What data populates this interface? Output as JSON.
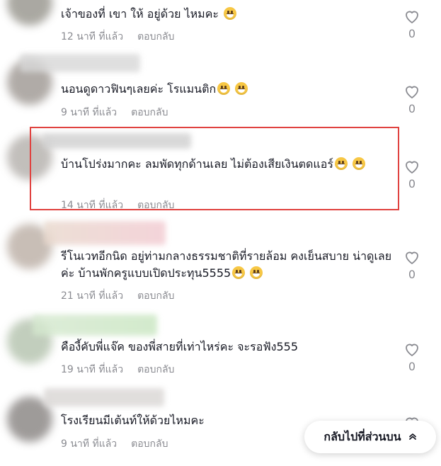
{
  "comments": [
    {
      "text": "เจ้าของที่ เขา ให้ อยู่ด้วย ไหมคะ",
      "emojis": [
        "grin-emoji"
      ],
      "time": "12 นาที ที่แล้ว",
      "reply": "ตอบกลับ",
      "likes": "0"
    },
    {
      "text": "นอนดูดาวฟินๆเลยค่ะ โรแมนติก",
      "emojis": [
        "smile-emoji",
        "smile-emoji"
      ],
      "time": "9 นาที ที่แล้ว",
      "reply": "ตอบกลับ",
      "likes": "0"
    },
    {
      "text": "บ้านโปร่งมากคะ ลมพัดทุกด้านเลย ไม่ต้องเสียเงินตดแอร์",
      "emojis": [
        "rofl-emoji",
        "rofl-emoji"
      ],
      "time": "14 นาที ที่แล้ว",
      "reply": "ตอบกลับ",
      "likes": "0"
    },
    {
      "text": "รีโนเวทอีกนิด อยู่ท่ามกลางธรรมชาติที่รายล้อม คงเย็นสบาย น่าดูเลยค่ะ บ้านพักครูแบบเปิดประทุน5555",
      "emojis": [
        "laugh-tears-emoji",
        "sweat-smile-emoji"
      ],
      "time": "21 นาที ที่แล้ว",
      "reply": "ตอบกลับ",
      "likes": "0"
    },
    {
      "text": "คืองี้คับพี่แจ๊ค ของพี่สายที่เท่าไหร่คะ จะรอฟัง555",
      "emojis": [],
      "time": "19 นาที ที่แล้ว",
      "reply": "ตอบกลับ",
      "likes": "0"
    },
    {
      "text": "โรงเรียนมีเต้นท์ให้ด้วยไหมคะ",
      "emojis": [],
      "time": "9 นาที ที่แล้ว",
      "reply": "ตอบกลับ",
      "likes": ""
    }
  ],
  "back_to_top": "กลับไปที่ส่วนบน",
  "colors": {
    "text": "#161823",
    "meta": "#8a8b91",
    "highlight": "#e0423f"
  }
}
